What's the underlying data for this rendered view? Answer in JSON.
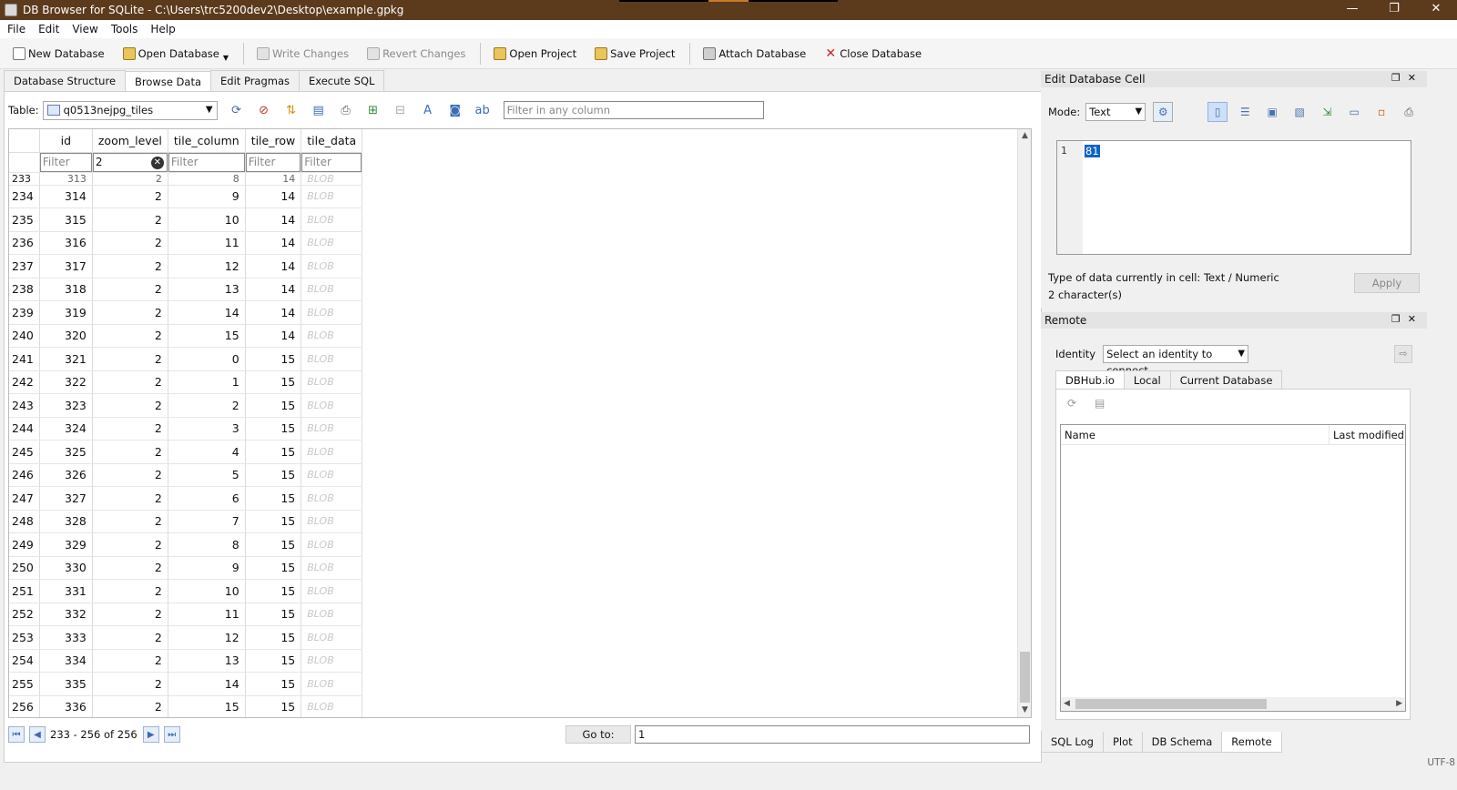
{
  "window": {
    "title": "DB Browser for SQLite - C:\\Users\\trc5200dev2\\Desktop\\example.gpkg",
    "controls": [
      "—",
      "❐",
      "✕"
    ]
  },
  "menu": [
    "File",
    "Edit",
    "View",
    "Tools",
    "Help"
  ],
  "toolbar": {
    "buttons": [
      {
        "label": "New Database",
        "icon": "new-database-icon",
        "enabled": true
      },
      {
        "label": "Open Database",
        "icon": "open-database-icon",
        "enabled": true
      },
      {
        "label": "Write Changes",
        "icon": "write-changes-icon",
        "enabled": false
      },
      {
        "label": "Revert Changes",
        "icon": "revert-changes-icon",
        "enabled": false
      },
      {
        "label": "Open Project",
        "icon": "open-project-icon",
        "enabled": true
      },
      {
        "label": "Save Project",
        "icon": "save-project-icon",
        "enabled": true
      },
      {
        "label": "Attach Database",
        "icon": "attach-database-icon",
        "enabled": true
      },
      {
        "label": "Close Database",
        "icon": "close-database-icon",
        "enabled": true
      }
    ]
  },
  "main_tabs": [
    "Database Structure",
    "Browse Data",
    "Edit Pragmas",
    "Execute SQL"
  ],
  "browse": {
    "table_label": "Table:",
    "table_value": "q0513nejpg_tiles",
    "filter_any_placeholder": "Filter in any column",
    "columns": [
      "id",
      "zoom_level",
      "tile_column",
      "tile_row",
      "tile_data"
    ],
    "filters": [
      "Filter",
      "2",
      "Filter",
      "Filter",
      "Filter"
    ],
    "partial_row": {
      "rownum": "233",
      "id": "313",
      "zoom_level": "2",
      "tile_column": "8",
      "tile_row": "14",
      "tile_data": "BLOB"
    },
    "rows": [
      [
        "234",
        "314",
        "2",
        "9",
        "14",
        "BLOB"
      ],
      [
        "235",
        "315",
        "2",
        "10",
        "14",
        "BLOB"
      ],
      [
        "236",
        "316",
        "2",
        "11",
        "14",
        "BLOB"
      ],
      [
        "237",
        "317",
        "2",
        "12",
        "14",
        "BLOB"
      ],
      [
        "238",
        "318",
        "2",
        "13",
        "14",
        "BLOB"
      ],
      [
        "239",
        "319",
        "2",
        "14",
        "14",
        "BLOB"
      ],
      [
        "240",
        "320",
        "2",
        "15",
        "14",
        "BLOB"
      ],
      [
        "241",
        "321",
        "2",
        "0",
        "15",
        "BLOB"
      ],
      [
        "242",
        "322",
        "2",
        "1",
        "15",
        "BLOB"
      ],
      [
        "243",
        "323",
        "2",
        "2",
        "15",
        "BLOB"
      ],
      [
        "244",
        "324",
        "2",
        "3",
        "15",
        "BLOB"
      ],
      [
        "245",
        "325",
        "2",
        "4",
        "15",
        "BLOB"
      ],
      [
        "246",
        "326",
        "2",
        "5",
        "15",
        "BLOB"
      ],
      [
        "247",
        "327",
        "2",
        "6",
        "15",
        "BLOB"
      ],
      [
        "248",
        "328",
        "2",
        "7",
        "15",
        "BLOB"
      ],
      [
        "249",
        "329",
        "2",
        "8",
        "15",
        "BLOB"
      ],
      [
        "250",
        "330",
        "2",
        "9",
        "15",
        "BLOB"
      ],
      [
        "251",
        "331",
        "2",
        "10",
        "15",
        "BLOB"
      ],
      [
        "252",
        "332",
        "2",
        "11",
        "15",
        "BLOB"
      ],
      [
        "253",
        "333",
        "2",
        "12",
        "15",
        "BLOB"
      ],
      [
        "254",
        "334",
        "2",
        "13",
        "15",
        "BLOB"
      ],
      [
        "255",
        "335",
        "2",
        "14",
        "15",
        "BLOB"
      ],
      [
        "256",
        "336",
        "2",
        "15",
        "15",
        "BLOB"
      ]
    ],
    "record_info": "233 - 256 of 256",
    "goto_label": "Go to:",
    "goto_value": "1"
  },
  "edit_cell": {
    "title": "Edit Database Cell",
    "mode_label": "Mode:",
    "mode_value": "Text",
    "line_number": "1",
    "cell_value": "81",
    "type_info": "Type of data currently in cell: Text / Numeric",
    "char_info": "2 character(s)",
    "apply_label": "Apply"
  },
  "remote": {
    "title": "Remote",
    "identity_label": "Identity",
    "identity_value": "Select an identity to connect",
    "tabs": [
      "DBHub.io",
      "Local",
      "Current Database"
    ],
    "columns": [
      "Name",
      "Last modified"
    ]
  },
  "bottom_tabs": [
    "SQL Log",
    "Plot",
    "DB Schema",
    "Remote"
  ],
  "status": {
    "encoding": "UTF-8"
  }
}
